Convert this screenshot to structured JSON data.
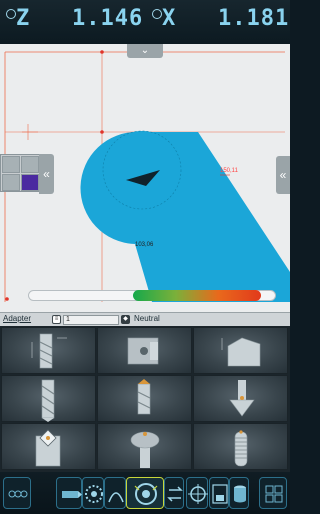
{
  "readout": {
    "z_label": "Z",
    "z_value": "1.146",
    "x_label": "X",
    "x_value": "1.181"
  },
  "viewport": {
    "dimension_label_1": "150,11",
    "dimension_label_2": "103,06",
    "collapse_icon": "chevron-double-down-icon",
    "side_handle_icon": "chevron-double-left-icon",
    "progress_fraction": 0.51,
    "colors": {
      "workpiece": "#1ba6d8",
      "guides": "#ef6b4b",
      "background": "#ebedee"
    }
  },
  "adapter_bar": {
    "adapter_label": "Adapter",
    "select_value": "1",
    "neutral_label": "Neutral"
  },
  "tools": [
    {
      "name": "end-mill"
    },
    {
      "name": "boring-bar"
    },
    {
      "name": "grooving-insert"
    },
    {
      "name": "drill"
    },
    {
      "name": "twist-drill"
    },
    {
      "name": "countersink"
    },
    {
      "name": "indexable-cutter"
    },
    {
      "name": "form-cutter"
    },
    {
      "name": "thread-mill"
    }
  ],
  "toolbar": {
    "buttons": [
      {
        "icon": "menu-grid-icon"
      },
      {
        "icon": "tool-holder-icon"
      },
      {
        "icon": "turret-icon"
      },
      {
        "icon": "path-icon"
      },
      {
        "icon": "spindle-icon"
      },
      {
        "icon": "swap-icon"
      },
      {
        "icon": "target-icon"
      },
      {
        "icon": "zx-save-icon"
      },
      {
        "icon": "database-icon"
      },
      {
        "icon": "grid-view-icon"
      }
    ]
  }
}
